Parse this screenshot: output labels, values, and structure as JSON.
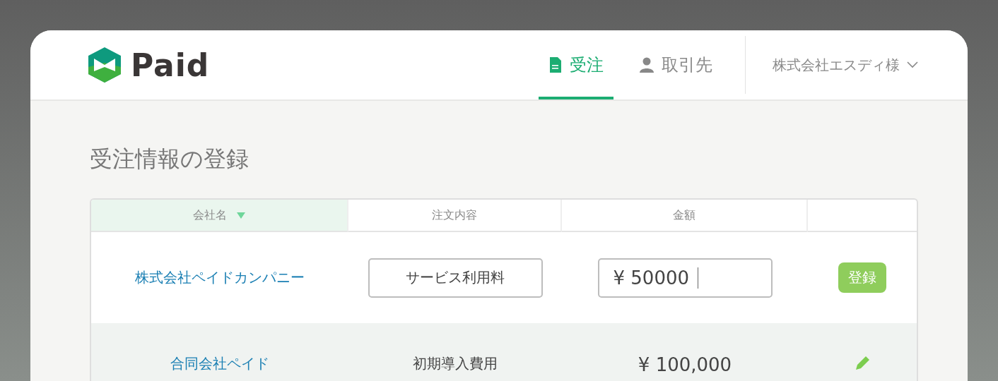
{
  "logo": {
    "text": "Paid"
  },
  "nav": {
    "tabs": [
      {
        "label": "受注",
        "kind": "document",
        "selected": true
      },
      {
        "label": "取引先",
        "kind": "person",
        "selected": false
      }
    ],
    "account": {
      "label": "株式会社エスディ様"
    }
  },
  "page": {
    "title": "受注情報の登録"
  },
  "table": {
    "columns": [
      {
        "label": "会社名",
        "sorted": true
      },
      {
        "label": "注文内容",
        "sorted": false
      },
      {
        "label": "金額",
        "sorted": false
      },
      {
        "sorted": false
      }
    ],
    "new_row": {
      "company": "株式会社ペイドカンパニー",
      "content": "サービス利用料",
      "amount": "¥ 50000",
      "button": "登録"
    },
    "rows": [
      {
        "company": "合同会社ペイド",
        "content": "初期導入費用",
        "amount": "¥ 100,000"
      }
    ]
  }
}
